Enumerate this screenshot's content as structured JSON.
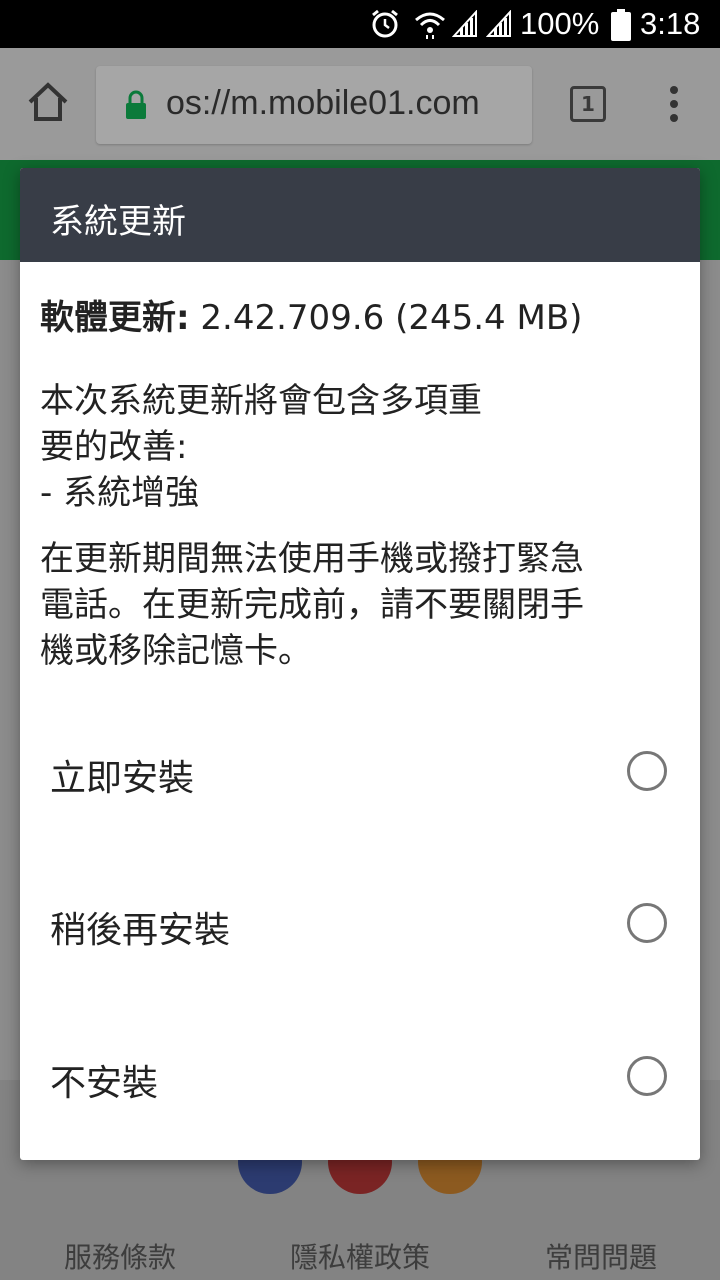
{
  "status_bar": {
    "battery": "100%",
    "time": "3:18",
    "icons": [
      "alarm-icon",
      "wifi-icon",
      "signal-icon",
      "signal-icon",
      "battery-icon"
    ]
  },
  "browser": {
    "url": "os://m.mobile01.com",
    "tab_count": "1",
    "icons": [
      "home-icon",
      "lock-icon",
      "tab-switcher-icon",
      "more-vert-icon"
    ]
  },
  "dialog": {
    "title": "系統更新",
    "version_label": "軟體更新:",
    "version_value": " 2.42.709.6 (245.4 MB)",
    "improve_lines": [
      "本次系統更新將會包含多項重",
      "要的改善:",
      "- 系統增強"
    ],
    "warning_lines": [
      "在更新期間無法使用手機或撥打緊急",
      "電話。在更新完成前，請不要關閉手",
      "機或移除記憶卡。"
    ],
    "options": [
      {
        "label": "立即安裝",
        "selected": false
      },
      {
        "label": "稍後再安裝",
        "selected": false
      },
      {
        "label": "不安裝",
        "selected": false
      }
    ]
  },
  "footer": {
    "links": [
      "服務條款",
      "隱私權政策",
      "常問問題"
    ],
    "icons": [
      "facebook-icon",
      "youtube-icon",
      "rss-icon"
    ]
  },
  "colors": {
    "dialog_header": "#383d47",
    "site_green": "#0e6a2e",
    "lock_green": "#0b7a3a"
  }
}
